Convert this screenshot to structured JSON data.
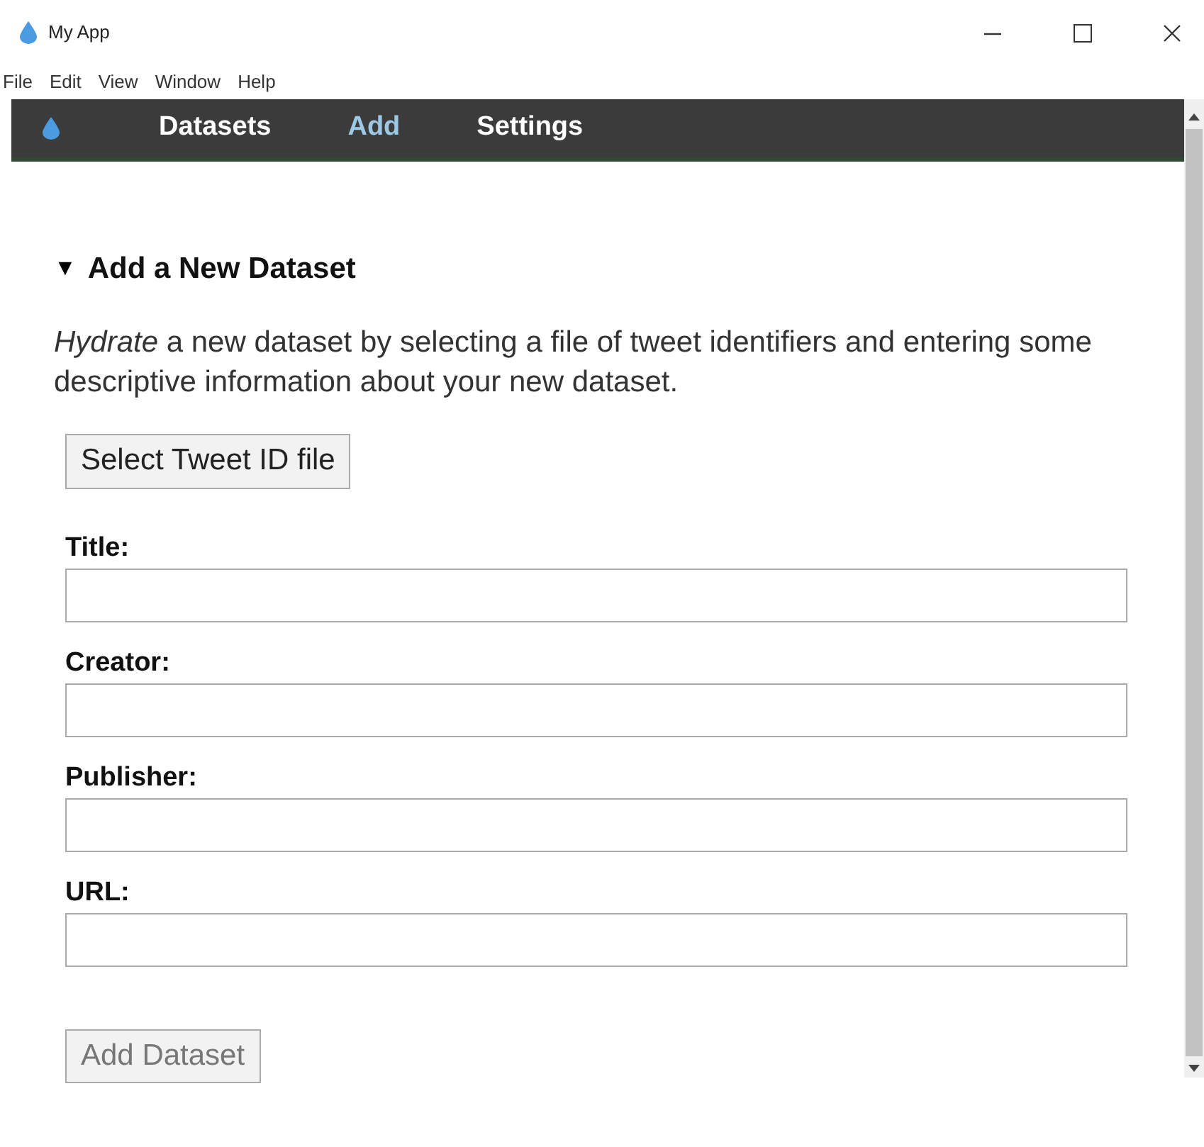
{
  "window": {
    "title": "My App"
  },
  "menu": [
    "File",
    "Edit",
    "View",
    "Window",
    "Help"
  ],
  "nav": [
    {
      "label": "Datasets",
      "selected": false
    },
    {
      "label": "Add",
      "selected": true
    },
    {
      "label": "Settings",
      "selected": false
    }
  ],
  "section": {
    "title": "Add a New Dataset",
    "expanded": true,
    "toggle": "▼",
    "description": "*Hydrate* a new dataset by selecting a file of tweet identifiers and entering some descriptive information about your new dataset."
  },
  "file_button": {
    "label": "Select Tweet ID file",
    "disabled": false
  },
  "fields": [
    {
      "label": "Title:"
    },
    {
      "label": "Creator:"
    },
    {
      "label": "Publisher:"
    },
    {
      "label": "URL:"
    }
  ],
  "submit_button": {
    "label": "Add Dataset",
    "disabled": true
  }
}
